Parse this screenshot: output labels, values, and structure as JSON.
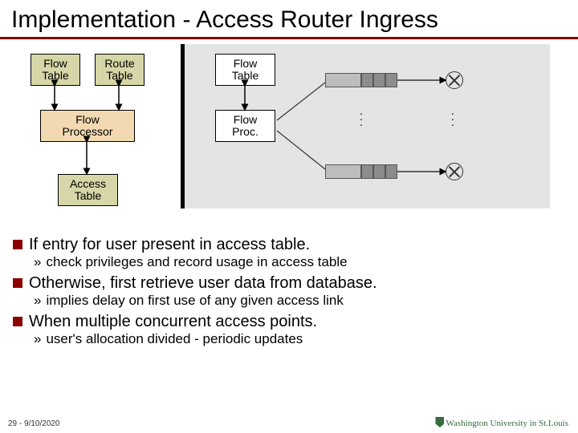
{
  "title": "Implementation - Access Router Ingress",
  "boxes": {
    "flow_table_left": "Flow\nTable",
    "route_table": "Route\nTable",
    "flow_processor": "Flow\nProcessor",
    "access_table": "Access\nTable",
    "flow_table_right": "Flow\nTable",
    "flow_proc_right": "Flow\nProc."
  },
  "bullets": {
    "b1": "If entry for user present in access table.",
    "s1": "check privileges and record usage in access table",
    "b2": "Otherwise, first retrieve user data from database.",
    "s2": "implies delay on first use of any given access link",
    "b3": "When multiple concurrent access points.",
    "s3": "user's allocation divided - periodic updates"
  },
  "footer": "29 - 9/10/2020",
  "logo_text": "Washington University in St.Louis"
}
